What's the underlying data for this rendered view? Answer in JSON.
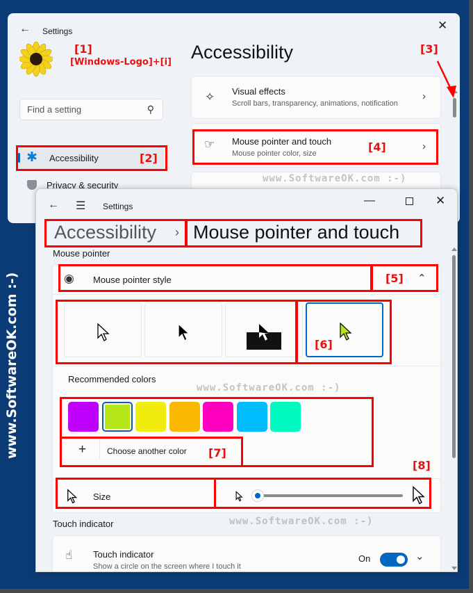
{
  "background_window": {
    "title": "Settings",
    "search": {
      "placeholder": "Find a setting"
    },
    "nav": {
      "items": [
        {
          "label": "Accessibility",
          "selected": true
        },
        {
          "label": "Privacy & security"
        }
      ]
    },
    "page_title": "Accessibility",
    "cards": [
      {
        "title": "Visual effects",
        "subtitle": "Scroll bars, transparency, animations, notification"
      },
      {
        "title": "Mouse pointer and touch",
        "subtitle": "Mouse pointer color, size"
      }
    ]
  },
  "foreground_window": {
    "title": "Settings",
    "breadcrumb": {
      "parent": "Accessibility",
      "separator": "›",
      "current": "Mouse pointer and touch"
    },
    "mouse_pointer_section": "Mouse pointer",
    "pointer_style": {
      "label": "Mouse pointer style",
      "options": [
        "white",
        "black",
        "inverted",
        "custom"
      ],
      "selected": "custom"
    },
    "recommended_colors": {
      "label": "Recommended colors",
      "colors": [
        "#bf00ff",
        "#b4e61a",
        "#f0ec0e",
        "#fbb800",
        "#ff00be",
        "#00bcff",
        "#00fac0"
      ],
      "selected_index": 1
    },
    "choose_color_label": "Choose another color",
    "size": {
      "label": "Size",
      "value_fraction": 0.0
    },
    "touch_section": "Touch indicator",
    "touch_indicator": {
      "title": "Touch indicator",
      "subtitle": "Show a circle on the screen where I touch it",
      "state_label": "On",
      "on": true
    }
  },
  "annotations": {
    "a1": "[1]",
    "a1_hint": "[Windows-Logo]+[i]",
    "a2": "[2]",
    "a3": "[3]",
    "a4": "[4]",
    "a5": "[5]",
    "a6": "[6]",
    "a7": "[7]",
    "a8": "[8]"
  },
  "watermark": {
    "text": "www.SoftwareOK.com :-)",
    "vertical": "www.SoftwareOK.com :-)"
  },
  "colors": {
    "accent": "#0067c0",
    "annotation": "#ff0000",
    "desktop": "#0b3b74"
  }
}
